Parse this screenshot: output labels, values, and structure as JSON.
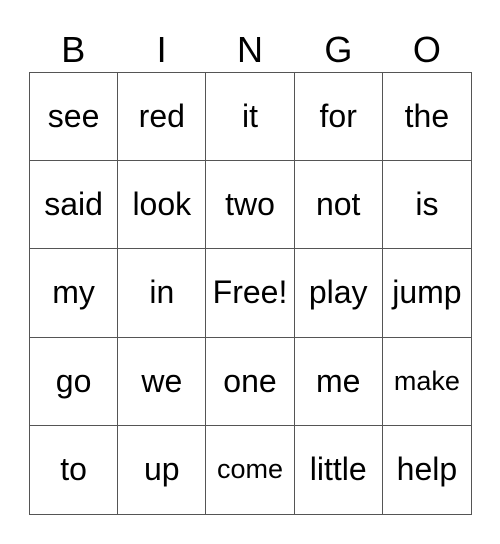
{
  "header": [
    "B",
    "I",
    "N",
    "G",
    "O"
  ],
  "cells": [
    [
      "see",
      "red",
      "it",
      "for",
      "the"
    ],
    [
      "said",
      "look",
      "two",
      "not",
      "is"
    ],
    [
      "my",
      "in",
      "Free!",
      "play",
      "jump"
    ],
    [
      "go",
      "we",
      "one",
      "me",
      "make"
    ],
    [
      "to",
      "up",
      "come",
      "little",
      "help"
    ]
  ]
}
